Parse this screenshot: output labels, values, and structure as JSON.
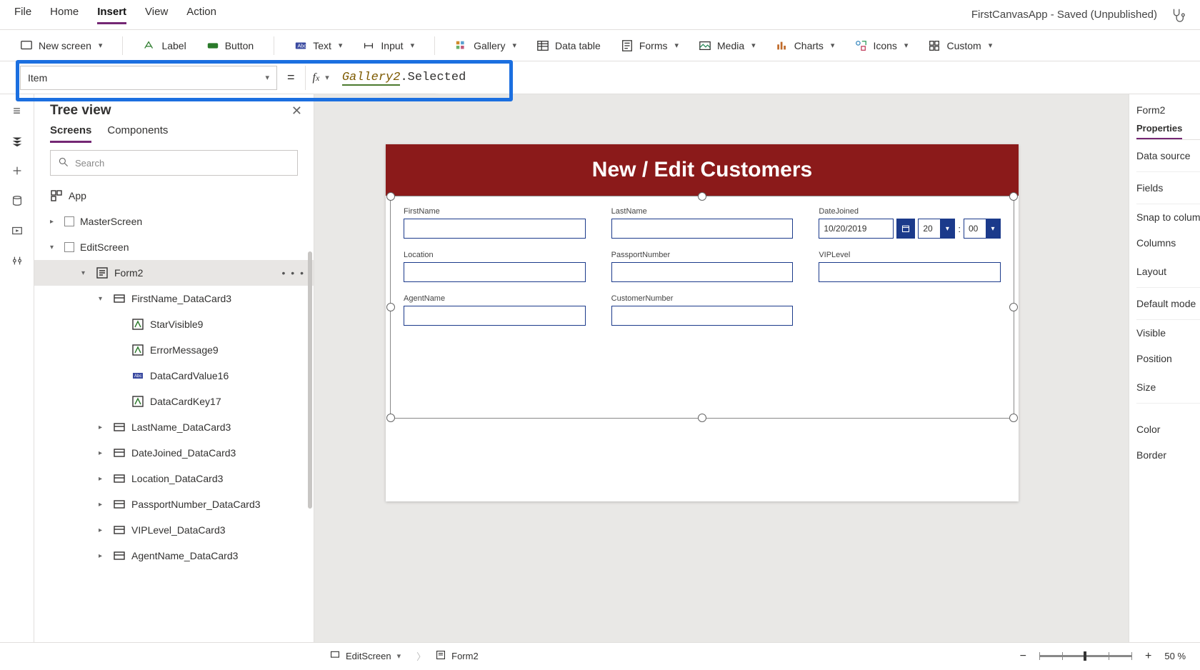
{
  "app_title": "FirstCanvasApp - Saved (Unpublished)",
  "menus": [
    "File",
    "Home",
    "Insert",
    "View",
    "Action"
  ],
  "active_menu": "Insert",
  "ribbon": {
    "new_screen": "New screen",
    "label": "Label",
    "button": "Button",
    "text": "Text",
    "input": "Input",
    "gallery": "Gallery",
    "data_table": "Data table",
    "forms": "Forms",
    "media": "Media",
    "charts": "Charts",
    "icons": "Icons",
    "custom": "Custom"
  },
  "formula_bar": {
    "property": "Item",
    "gallery_name": "Gallery2",
    "suffix": ".Selected",
    "intellisense": "Selected"
  },
  "tree": {
    "title": "Tree view",
    "tabs": {
      "screens": "Screens",
      "components": "Components"
    },
    "search_placeholder": "Search",
    "app": "App",
    "items": [
      {
        "label": "MasterScreen"
      },
      {
        "label": "EditScreen"
      },
      {
        "label": "Form2"
      },
      {
        "label": "FirstName_DataCard3"
      },
      {
        "label": "StarVisible9"
      },
      {
        "label": "ErrorMessage9"
      },
      {
        "label": "DataCardValue16"
      },
      {
        "label": "DataCardKey17"
      },
      {
        "label": "LastName_DataCard3"
      },
      {
        "label": "DateJoined_DataCard3"
      },
      {
        "label": "Location_DataCard3"
      },
      {
        "label": "PassportNumber_DataCard3"
      },
      {
        "label": "VIPLevel_DataCard3"
      },
      {
        "label": "AgentName_DataCard3"
      }
    ]
  },
  "canvas": {
    "screen_title": "New / Edit Customers",
    "fields": {
      "first_name": "FirstName",
      "last_name": "LastName",
      "date_joined": "DateJoined",
      "date_value": "10/20/2019",
      "hour": "20",
      "minute": "00",
      "location": "Location",
      "passport": "PassportNumber",
      "vip": "VIPLevel",
      "agent": "AgentName",
      "cust_num": "CustomerNumber"
    }
  },
  "props": {
    "selected": "Form2",
    "tab_properties": "Properties",
    "rows": {
      "data_source": "Data source",
      "fields": "Fields",
      "snap": "Snap to columns",
      "columns": "Columns",
      "layout": "Layout",
      "default_mode": "Default mode",
      "visible": "Visible",
      "position": "Position",
      "size": "Size",
      "color": "Color",
      "border": "Border"
    }
  },
  "footer": {
    "screen": "EditScreen",
    "element": "Form2",
    "zoom_value": "50",
    "zoom_unit": "%"
  }
}
